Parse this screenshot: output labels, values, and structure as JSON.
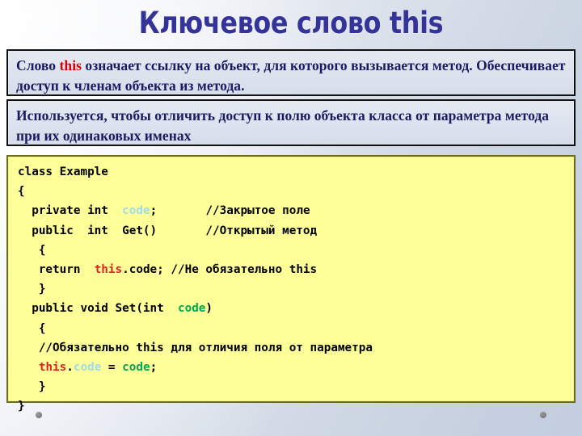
{
  "slide": {
    "title": "Ключевое слово this",
    "title_color": "#333399",
    "background_colors": [
      "#fdfdfe",
      "#c3cedf"
    ]
  },
  "statements": [
    {
      "id": "statement-1",
      "parts": [
        {
          "text": "Слово ",
          "style": "plain"
        },
        {
          "text": "this",
          "style": "keyword"
        },
        {
          "text": " означает ссылку на объект, для которого вызывается метод. Обеспечивает доступ к членам объекта из метода.",
          "style": "plain"
        }
      ]
    },
    {
      "id": "statement-2",
      "parts": [
        {
          "text": "Используется, чтобы отличить доступ к полю объекта класса от параметра метода при их одинаковых именах",
          "style": "plain"
        }
      ]
    }
  ],
  "code": {
    "language": "csharp",
    "background_color": "#ffff99",
    "border_color": "#6b6b1f",
    "token_colors": {
      "this": "#e02020",
      "field": "#9fdcea",
      "param": "#00a651",
      "plain": "#000000",
      "comment": "#000000"
    },
    "lines": [
      [
        {
          "t": "class Example",
          "c": "plain"
        }
      ],
      [
        {
          "t": "{",
          "c": "plain"
        }
      ],
      [
        {
          "t": "  private int  ",
          "c": "plain"
        },
        {
          "t": "code",
          "c": "field"
        },
        {
          "t": ";       ",
          "c": "plain"
        },
        {
          "t": "//Закрытое поле",
          "c": "comment"
        }
      ],
      [
        {
          "t": "  public  int  Get()       ",
          "c": "plain"
        },
        {
          "t": "//Открытый метод",
          "c": "comment"
        }
      ],
      [
        {
          "t": "   {",
          "c": "plain"
        }
      ],
      [
        {
          "t": "   return  ",
          "c": "plain"
        },
        {
          "t": "this",
          "c": "this"
        },
        {
          "t": ".code; ",
          "c": "plain"
        },
        {
          "t": "//Не обязательно this",
          "c": "comment"
        }
      ],
      [
        {
          "t": "   }",
          "c": "plain"
        }
      ],
      [
        {
          "t": "  public void Set(int  ",
          "c": "plain"
        },
        {
          "t": "code",
          "c": "param"
        },
        {
          "t": ")",
          "c": "plain"
        }
      ],
      [
        {
          "t": "   {",
          "c": "plain"
        }
      ],
      [
        {
          "t": "   ",
          "c": "plain"
        },
        {
          "t": "//Обязательно this для отличия поля от параметра",
          "c": "comment"
        }
      ],
      [
        {
          "t": "   ",
          "c": "plain"
        },
        {
          "t": "this",
          "c": "this"
        },
        {
          "t": ".",
          "c": "plain"
        },
        {
          "t": "code",
          "c": "field"
        },
        {
          "t": " = ",
          "c": "plain"
        },
        {
          "t": "code",
          "c": "param"
        },
        {
          "t": ";",
          "c": "plain"
        }
      ],
      [
        {
          "t": "   }",
          "c": "plain"
        }
      ],
      [
        {
          "t": "}",
          "c": "plain"
        }
      ]
    ]
  },
  "decorations": {
    "dots": [
      {
        "name": "deco-dot-left",
        "color": "#7d7d7d"
      },
      {
        "name": "deco-dot-right",
        "color": "#7d7d7d"
      }
    ]
  }
}
